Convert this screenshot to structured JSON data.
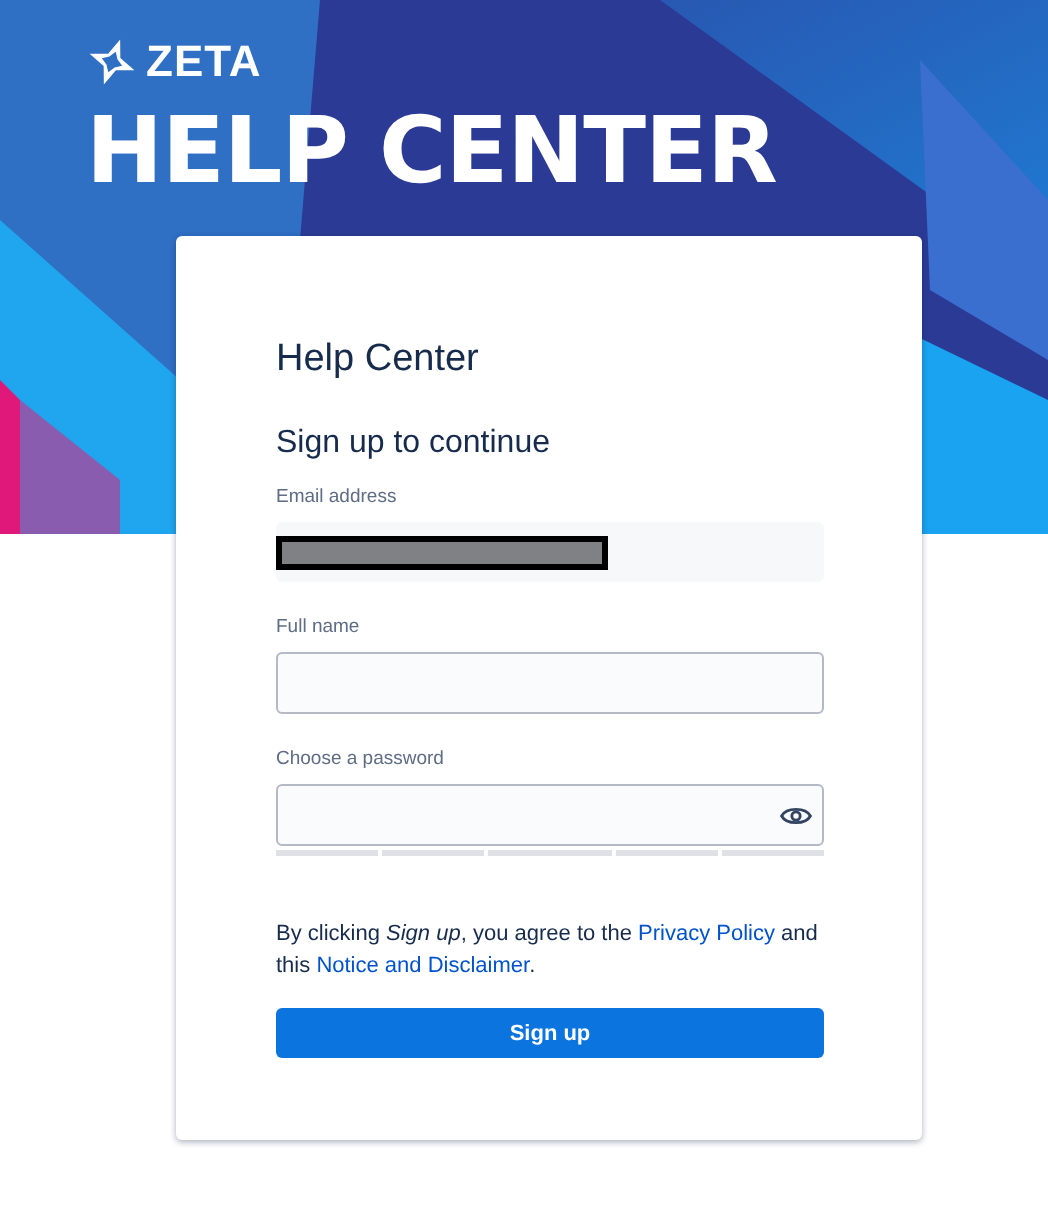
{
  "brand": {
    "logo": "ZETA",
    "title": "HELP CENTER"
  },
  "card": {
    "title": "Help Center",
    "subtitle": "Sign up to continue"
  },
  "fields": [
    {
      "kind": "redacted",
      "label": "Email address"
    },
    {
      "kind": "text",
      "label": "Full name"
    },
    {
      "kind": "password",
      "label": "Choose a password"
    }
  ],
  "terms": [
    {
      "kind": "text",
      "text": "By clicking *Sign up*, you agree to the "
    },
    {
      "kind": "link",
      "text": "Privacy Policy"
    },
    {
      "kind": "text",
      "text": " and this "
    },
    {
      "kind": "link",
      "text": "Notice and Disclaimer"
    },
    {
      "kind": "text",
      "text": "."
    }
  ],
  "submit": "Sign up"
}
